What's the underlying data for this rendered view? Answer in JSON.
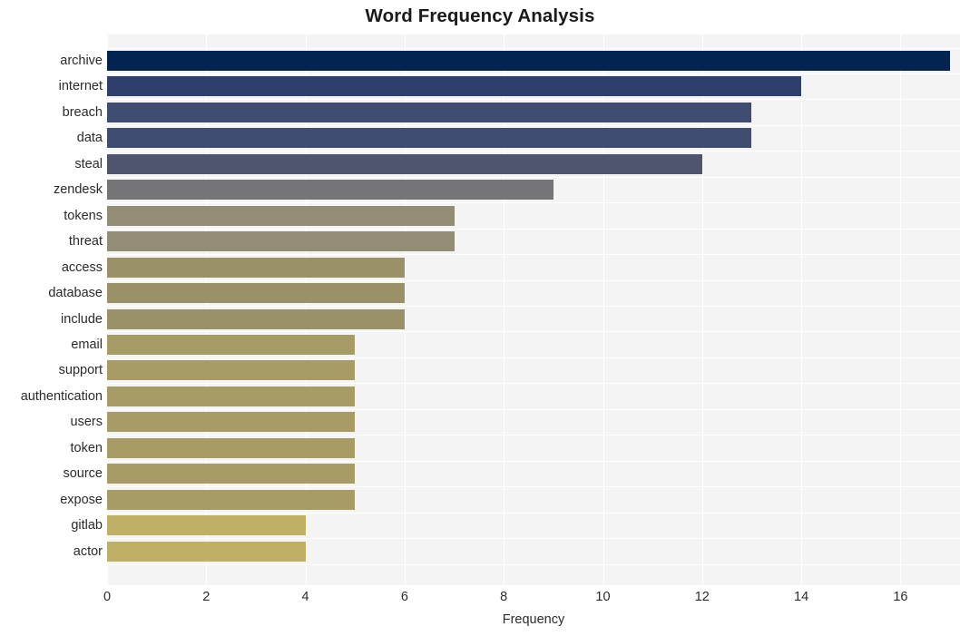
{
  "chart_data": {
    "type": "bar",
    "orientation": "horizontal",
    "title": "Word Frequency Analysis",
    "xlabel": "Frequency",
    "ylabel": "",
    "xlim": [
      0,
      17.2
    ],
    "ylim": null,
    "grid": true,
    "legend": null,
    "xticks": [
      0,
      2,
      4,
      6,
      8,
      10,
      12,
      14,
      16
    ],
    "xticklabels": [
      "0",
      "2",
      "4",
      "6",
      "8",
      "10",
      "12",
      "14",
      "16"
    ],
    "categories": [
      "archive",
      "internet",
      "breach",
      "data",
      "steal",
      "zendesk",
      "tokens",
      "threat",
      "access",
      "database",
      "include",
      "email",
      "support",
      "authentication",
      "users",
      "token",
      "source",
      "expose",
      "gitlab",
      "actor"
    ],
    "values": [
      17,
      14,
      13,
      13,
      12,
      9,
      7,
      7,
      6,
      6,
      6,
      5,
      5,
      5,
      5,
      5,
      5,
      5,
      4,
      4
    ],
    "bar_colors": [
      "#032450",
      "#2f3f6b",
      "#414d70",
      "#414d70",
      "#4f546f",
      "#757577",
      "#938d76",
      "#938d76",
      "#9a9169",
      "#9a9169",
      "#9a9169",
      "#a79c66",
      "#a79c66",
      "#a79c66",
      "#a79c66",
      "#a79c66",
      "#a79c66",
      "#a79c66",
      "#bfb065",
      "#bfb065"
    ],
    "plot_background": "#f4f4f5",
    "grid_color": "#ffffff",
    "figure_background": "#ffffff",
    "text_color": "#2b2b2b"
  }
}
